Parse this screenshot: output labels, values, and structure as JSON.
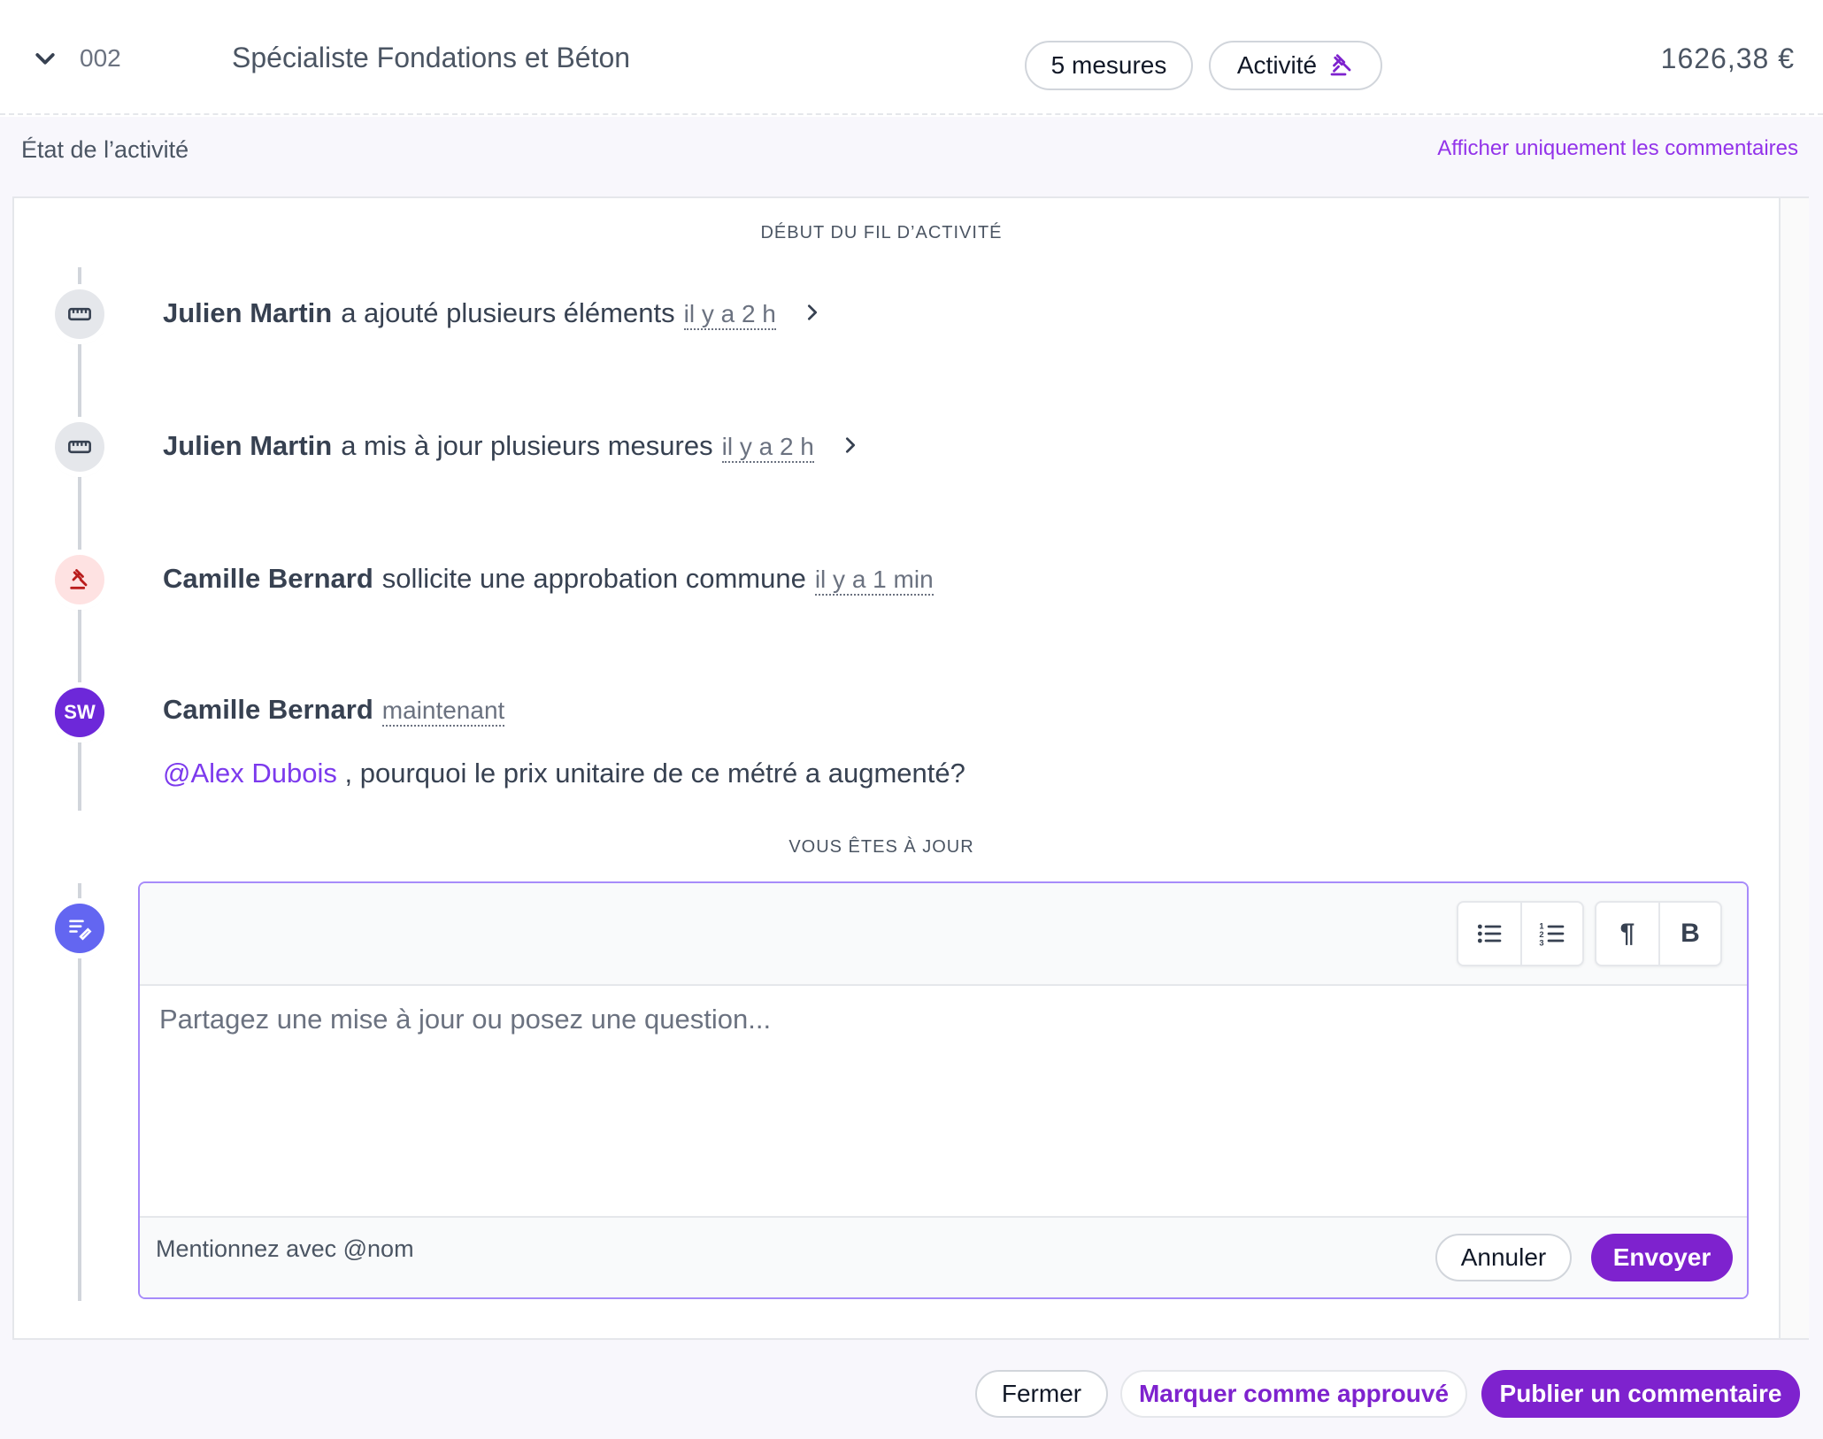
{
  "header": {
    "code": "002",
    "title": "Spécialiste Fondations et Béton",
    "measures_pill": "5 mesures",
    "activity_pill": "Activité",
    "amount": "1626,38 €"
  },
  "section": {
    "title": "État de l’activité",
    "filter_link": "Afficher uniquement les commentaires"
  },
  "feed": {
    "start_label": "DÉBUT DU FIL D’ACTIVITÉ",
    "end_label": "VOUS ÊTES À JOUR",
    "events": [
      {
        "icon": "ruler-icon",
        "name": "Julien Martin",
        "action": "a ajouté plusieurs éléments",
        "time": "il y a 2 h"
      },
      {
        "icon": "ruler-icon",
        "name": "Julien Martin",
        "action": "a mis à jour plusieurs mesures",
        "time": "il y a 2 h"
      },
      {
        "icon": "gavel-icon",
        "name": "Camille Bernard",
        "action": "sollicite une approbation commune",
        "time": "il y a 1 min"
      }
    ],
    "comment": {
      "avatar_initials": "SW",
      "name": "Camille Bernard",
      "time": "maintenant",
      "mention": "@Alex Dubois",
      "text": " , pourquoi le prix unitaire de ce métré a augmenté?"
    }
  },
  "editor": {
    "placeholder": "Partagez une mise à jour ou posez une question...",
    "toolbar": {
      "bullet_list": "bullet-list-icon",
      "numbered_list": "numbered-list-icon",
      "paragraph": "¶",
      "bold": "B"
    },
    "hint": "Mentionnez avec @nom",
    "cancel_label": "Annuler",
    "send_label": "Envoyer"
  },
  "footer": {
    "close_label": "Fermer",
    "approve_label": "Marquer comme approuvé",
    "publish_label": "Publier un commentaire"
  },
  "colors": {
    "accent": "#7e22ce",
    "mention": "#7c3aed",
    "compose_icon": "#6366f1",
    "avatar": "#6d28d9",
    "alert_bg": "#fee2e2",
    "alert_fg": "#b91c1c"
  }
}
